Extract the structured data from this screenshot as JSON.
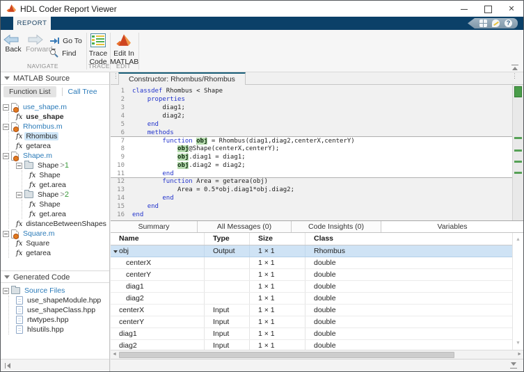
{
  "window": {
    "title": "HDL Coder Report Viewer",
    "controls": [
      "minimize-icon",
      "maximize-icon",
      "close-icon"
    ]
  },
  "ribbon": {
    "tab": "REPORT",
    "quick_icons": [
      "layout-grid-icon",
      "feedback-icon",
      "help-icon"
    ]
  },
  "toolbar": {
    "back": "Back",
    "forward": "Forward",
    "goto": "Go To",
    "find": "Find",
    "trace_code": "Trace Code",
    "edit_in_matlab": "Edit In MATLAB",
    "groups": {
      "navigate": "NAVIGATE",
      "trace": "TRACE",
      "edit": "EDIT"
    }
  },
  "sidebar": {
    "matlab_source": {
      "title": "MATLAB Source",
      "tabs": [
        {
          "label": "Function List",
          "selected": true
        },
        {
          "label": "Call Tree",
          "selected": false
        }
      ],
      "tree": [
        {
          "kind": "mfile",
          "label": "use_shape.m",
          "children": [
            {
              "kind": "fn",
              "label": "use_shape",
              "bold": true
            }
          ]
        },
        {
          "kind": "mfile",
          "label": "Rhombus.m",
          "children": [
            {
              "kind": "fn",
              "label": "Rhombus",
              "selected": true
            },
            {
              "kind": "fn",
              "label": "getarea"
            }
          ]
        },
        {
          "kind": "mfile",
          "label": "Shape.m",
          "children": [
            {
              "kind": "folder",
              "label": "Shape",
              "badge": "1",
              "children": [
                {
                  "kind": "fn",
                  "label": "Shape"
                },
                {
                  "kind": "fn",
                  "label": "get.area"
                }
              ]
            },
            {
              "kind": "folder",
              "label": "Shape",
              "badge": "2",
              "children": [
                {
                  "kind": "fn",
                  "label": "Shape"
                },
                {
                  "kind": "fn",
                  "label": "get.area"
                }
              ]
            },
            {
              "kind": "fn",
              "label": "distanceBetweenShapes"
            }
          ]
        },
        {
          "kind": "mfile",
          "label": "Square.m",
          "children": [
            {
              "kind": "fn",
              "label": "Square"
            },
            {
              "kind": "fn",
              "label": "getarea"
            }
          ]
        }
      ]
    },
    "generated_code": {
      "title": "Generated Code",
      "tree": [
        {
          "kind": "folder",
          "label": "Source Files",
          "link": true,
          "children": [
            {
              "kind": "doc",
              "label": "use_shapeModule.hpp"
            },
            {
              "kind": "doc",
              "label": "use_shapeClass.hpp"
            },
            {
              "kind": "doc",
              "label": "rtwtypes.hpp"
            },
            {
              "kind": "doc",
              "label": "hlsutils.hpp"
            }
          ]
        }
      ]
    }
  },
  "editor": {
    "tab": "Constructor: Rhombus/Rhombus",
    "block_lines": [
      7,
      11
    ],
    "lines": [
      {
        "n": 1,
        "segs": [
          [
            "kw",
            "classdef"
          ],
          [
            "p",
            " Rhombus < Shape"
          ]
        ]
      },
      {
        "n": 2,
        "segs": [
          [
            "p",
            "    "
          ],
          [
            "kw",
            "properties"
          ]
        ]
      },
      {
        "n": 3,
        "segs": [
          [
            "p",
            "        diag1;"
          ]
        ]
      },
      {
        "n": 4,
        "segs": [
          [
            "p",
            "        diag2;"
          ]
        ]
      },
      {
        "n": 5,
        "segs": [
          [
            "p",
            "    "
          ],
          [
            "kw",
            "end"
          ]
        ]
      },
      {
        "n": 6,
        "segs": [
          [
            "p",
            "    "
          ],
          [
            "kw",
            "methods"
          ]
        ]
      },
      {
        "n": 7,
        "segs": [
          [
            "p",
            "        "
          ],
          [
            "kw",
            "function"
          ],
          [
            "p",
            " "
          ],
          [
            "hl",
            "obj"
          ],
          [
            "p",
            " = Rhombus(diag1,diag2,centerX,centerY)"
          ]
        ]
      },
      {
        "n": 8,
        "segs": [
          [
            "p",
            "            "
          ],
          [
            "hl",
            "obj"
          ],
          [
            "p",
            "@Shape(centerX,centerY);"
          ]
        ]
      },
      {
        "n": 9,
        "segs": [
          [
            "p",
            "            "
          ],
          [
            "hl",
            "obj"
          ],
          [
            "p",
            ".diag1 = diag1;"
          ]
        ]
      },
      {
        "n": 10,
        "segs": [
          [
            "p",
            "            "
          ],
          [
            "hl",
            "obj"
          ],
          [
            "p",
            ".diag2 = diag2;"
          ]
        ]
      },
      {
        "n": 11,
        "segs": [
          [
            "p",
            "        "
          ],
          [
            "kw",
            "end"
          ]
        ]
      },
      {
        "n": 12,
        "segs": [
          [
            "p",
            "        "
          ],
          [
            "kw",
            "function"
          ],
          [
            "p",
            " Area = getarea(obj)"
          ]
        ]
      },
      {
        "n": 13,
        "segs": [
          [
            "p",
            "            Area = 0.5*obj.diag1*obj.diag2;"
          ]
        ]
      },
      {
        "n": 14,
        "segs": [
          [
            "p",
            "        "
          ],
          [
            "kw",
            "end"
          ]
        ]
      },
      {
        "n": 15,
        "segs": [
          [
            "p",
            "    "
          ],
          [
            "kw",
            "end"
          ]
        ]
      },
      {
        "n": 16,
        "segs": [
          [
            "kw",
            "end"
          ]
        ]
      }
    ]
  },
  "bottom_panel": {
    "tabs": [
      "Summary",
      "All Messages (0)",
      "Code Insights (0)",
      "Variables"
    ],
    "selected_tab": "Variables",
    "columns": [
      "Name",
      "Type",
      "Size",
      "Class"
    ],
    "rows": [
      {
        "name": "obj",
        "type": "Output",
        "size": "1 × 1",
        "class": "Rhombus",
        "indent": 0,
        "expanded": true,
        "selected": true
      },
      {
        "name": "centerX",
        "type": "",
        "size": "1 × 1",
        "class": "double",
        "indent": 1
      },
      {
        "name": "centerY",
        "type": "",
        "size": "1 × 1",
        "class": "double",
        "indent": 1
      },
      {
        "name": "diag1",
        "type": "",
        "size": "1 × 1",
        "class": "double",
        "indent": 1
      },
      {
        "name": "diag2",
        "type": "",
        "size": "1 × 1",
        "class": "double",
        "indent": 1
      },
      {
        "name": "centerX",
        "type": "Input",
        "size": "1 × 1",
        "class": "double",
        "indent": 0
      },
      {
        "name": "centerY",
        "type": "Input",
        "size": "1 × 1",
        "class": "double",
        "indent": 0
      },
      {
        "name": "diag1",
        "type": "Input",
        "size": "1 × 1",
        "class": "double",
        "indent": 0
      },
      {
        "name": "diag2",
        "type": "Input",
        "size": "1 × 1",
        "class": "double",
        "indent": 0
      }
    ]
  },
  "colors": {
    "ribbon_navy": "#0b4068",
    "editor_tab_accent": "#175d77",
    "link_blue": "#2a7ab8",
    "trace_highlight_green": "#b7dcb0",
    "selection_blue": "#cfe3f5",
    "badge_green": "#3a9a3a"
  }
}
